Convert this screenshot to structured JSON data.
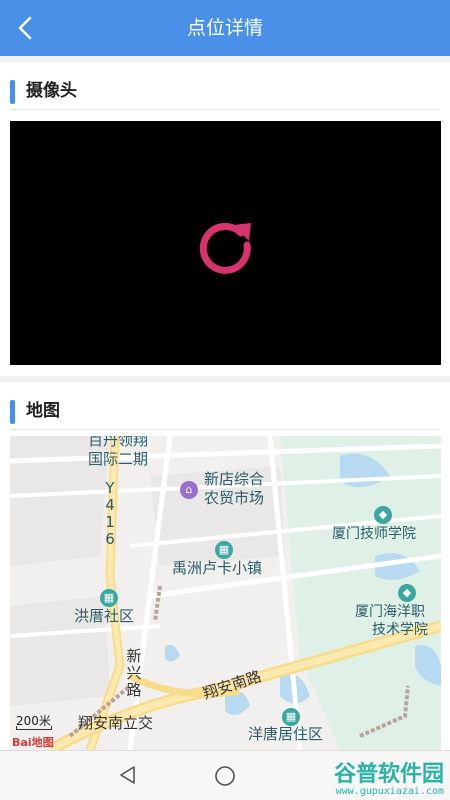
{
  "header": {
    "title": "点位详情"
  },
  "camera_section": {
    "title": "摄像头"
  },
  "map_section": {
    "title": "地图",
    "labels": {
      "top1": "百丹领翔",
      "top2": "国际二期",
      "market1": "新店综合",
      "market2": "农贸市场",
      "school1": "厦门技师学院",
      "town": "禹洲卢卡小镇",
      "hongtang": "洪厝社区",
      "haiyang1": "厦门海洋职",
      "haiyang2": "技术学院",
      "xinxing1": "新",
      "xinxing2": "兴",
      "xinxing3": "路",
      "road1": "翔安南路",
      "road2": "翔安南立交",
      "yangtang": "洋唐居住区",
      "y416_1": "Y",
      "y416_2": "4",
      "y416_3": "1",
      "y416_4": "6"
    },
    "scale": "200米",
    "logo": "Bai地图"
  },
  "watermark": {
    "big": "谷普软件园",
    "small": "www.gupuxiazai.com"
  },
  "colors": {
    "accent": "#4a90e8",
    "refresh": "#d6336f"
  }
}
